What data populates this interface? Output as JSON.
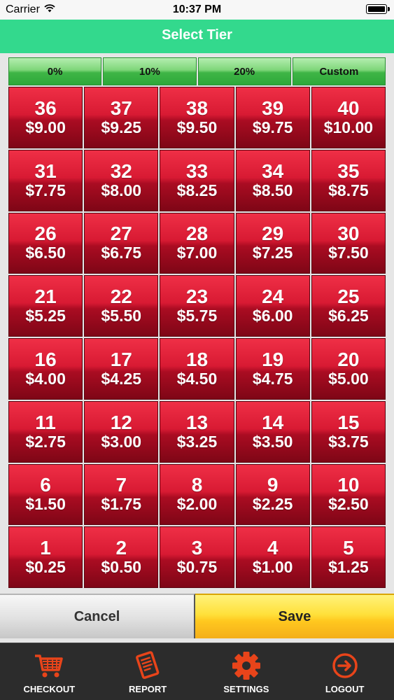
{
  "status_bar": {
    "carrier": "Carrier",
    "time": "10:37 PM"
  },
  "header": {
    "title": "Select Tier"
  },
  "percent_options": [
    "0%",
    "10%",
    "20%",
    "Custom"
  ],
  "tiers": [
    {
      "num": "36",
      "price": "$9.00"
    },
    {
      "num": "37",
      "price": "$9.25"
    },
    {
      "num": "38",
      "price": "$9.50"
    },
    {
      "num": "39",
      "price": "$9.75"
    },
    {
      "num": "40",
      "price": "$10.00"
    },
    {
      "num": "31",
      "price": "$7.75"
    },
    {
      "num": "32",
      "price": "$8.00"
    },
    {
      "num": "33",
      "price": "$8.25"
    },
    {
      "num": "34",
      "price": "$8.50"
    },
    {
      "num": "35",
      "price": "$8.75"
    },
    {
      "num": "26",
      "price": "$6.50"
    },
    {
      "num": "27",
      "price": "$6.75"
    },
    {
      "num": "28",
      "price": "$7.00"
    },
    {
      "num": "29",
      "price": "$7.25"
    },
    {
      "num": "30",
      "price": "$7.50"
    },
    {
      "num": "21",
      "price": "$5.25"
    },
    {
      "num": "22",
      "price": "$5.50"
    },
    {
      "num": "23",
      "price": "$5.75"
    },
    {
      "num": "24",
      "price": "$6.00"
    },
    {
      "num": "25",
      "price": "$6.25"
    },
    {
      "num": "16",
      "price": "$4.00"
    },
    {
      "num": "17",
      "price": "$4.25"
    },
    {
      "num": "18",
      "price": "$4.50"
    },
    {
      "num": "19",
      "price": "$4.75"
    },
    {
      "num": "20",
      "price": "$5.00"
    },
    {
      "num": "11",
      "price": "$2.75"
    },
    {
      "num": "12",
      "price": "$3.00"
    },
    {
      "num": "13",
      "price": "$3.25"
    },
    {
      "num": "14",
      "price": "$3.50"
    },
    {
      "num": "15",
      "price": "$3.75"
    },
    {
      "num": "6",
      "price": "$1.50"
    },
    {
      "num": "7",
      "price": "$1.75"
    },
    {
      "num": "8",
      "price": "$2.00"
    },
    {
      "num": "9",
      "price": "$2.25"
    },
    {
      "num": "10",
      "price": "$2.50"
    },
    {
      "num": "1",
      "price": "$0.25"
    },
    {
      "num": "2",
      "price": "$0.50"
    },
    {
      "num": "3",
      "price": "$0.75"
    },
    {
      "num": "4",
      "price": "$1.00"
    },
    {
      "num": "5",
      "price": "$1.25"
    }
  ],
  "actions": {
    "cancel_label": "Cancel",
    "save_label": "Save"
  },
  "tab_bar": {
    "items": [
      {
        "label": "CHECKOUT",
        "icon": "cart-icon"
      },
      {
        "label": "REPORT",
        "icon": "report-icon"
      },
      {
        "label": "SETTINGS",
        "icon": "gear-icon"
      },
      {
        "label": "LOGOUT",
        "icon": "logout-icon"
      }
    ]
  },
  "colors": {
    "header": "#33d98d",
    "tier_red": "#d81a33",
    "percent_green": "#3fb546",
    "save_yellow": "#ffd02a",
    "tab_bar": "#2c2c2c",
    "icon_orange": "#e8441a"
  }
}
